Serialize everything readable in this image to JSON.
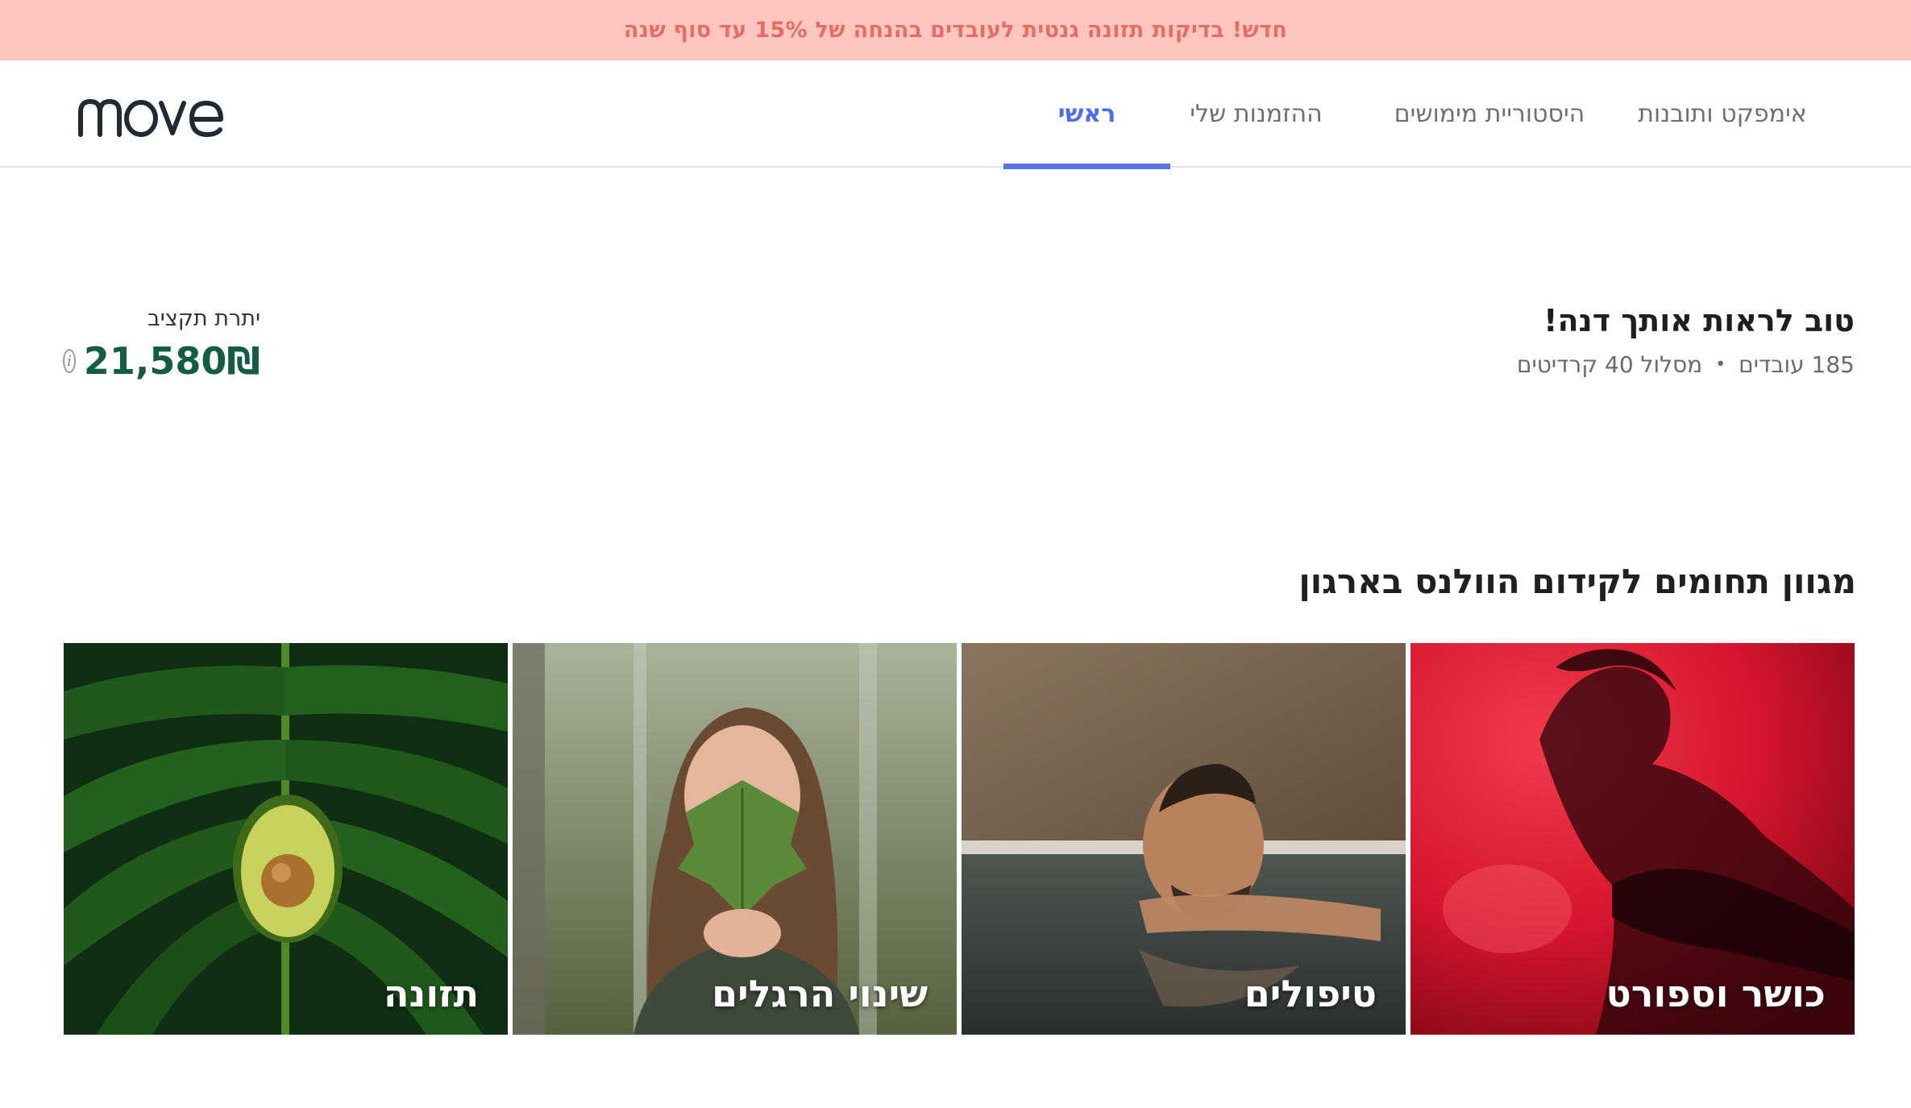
{
  "banner": {
    "text": "חדש! בדיקות תזונה גנטית לעובדים בהנחה של 15% עד סוף שנה"
  },
  "logo": {
    "text": "move"
  },
  "nav": {
    "tabs": [
      {
        "label": "ראשי",
        "active": true
      },
      {
        "label": "ההזמנות שלי",
        "active": false
      },
      {
        "label": "היסטוריית מימושים",
        "active": false
      },
      {
        "label": "אימפקט ותובנות",
        "active": false
      }
    ]
  },
  "greeting": {
    "title": "טוב לראות אותך דנה!",
    "employees": "185 עובדים",
    "separator": "•",
    "plan": "מסלול 40 קרדיטים"
  },
  "budget": {
    "label": "יתרת תקציב",
    "amount": "21,580₪",
    "info_icon": "info-icon"
  },
  "categories": {
    "title": "מגוון תחומים לקידום הוולנס בארגון",
    "items": [
      {
        "label": "כושר וספורט",
        "image": "fitness-photo"
      },
      {
        "label": "טיפולים",
        "image": "treatments-photo"
      },
      {
        "label": "שינוי הרגלים",
        "image": "habits-photo"
      },
      {
        "label": "תזונה",
        "image": "nutrition-photo"
      }
    ]
  },
  "colors": {
    "banner_bg": "#ffc6c0",
    "banner_text": "#e56e63",
    "active_tab": "#4f6ce8",
    "budget_amount": "#145c45"
  }
}
